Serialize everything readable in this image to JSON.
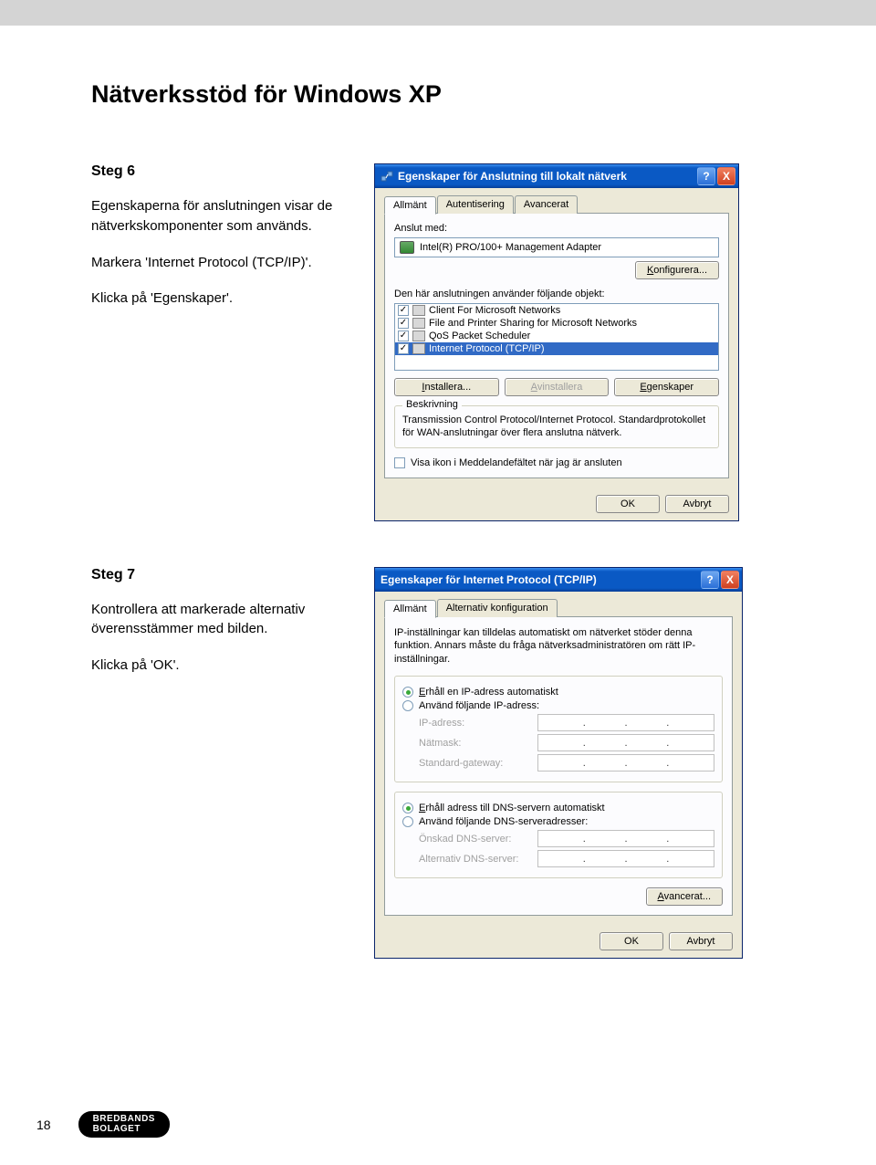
{
  "page": {
    "title": "Nätverksstöd för Windows XP",
    "number": "18",
    "logo_line1": "BREDBANDS",
    "logo_line2": "BOLAGET"
  },
  "step6": {
    "heading": "Steg 6",
    "p1": "Egenskaperna för anslutningen visar de nätverkskomponenter som används.",
    "p2": "Markera 'Internet Protocol (TCP/IP)'.",
    "p3": "Klicka på 'Egenskaper'."
  },
  "step7": {
    "heading": "Steg 7",
    "p1": "Kontrollera att markerade alternativ överensstämmer med bilden.",
    "p2": "Klicka på 'OK'."
  },
  "win1": {
    "title": "Egenskaper för Anslutning till lokalt nätverk",
    "help": "?",
    "close": "X",
    "tabs": {
      "t1": "Allmänt",
      "t2": "Autentisering",
      "t3": "Avancerat"
    },
    "connect_with_label": "Anslut med:",
    "adapter": "Intel(R) PRO/100+ Management Adapter",
    "configure_btn": "Konfigurera...",
    "components_label": "Den här anslutningen använder följande objekt:",
    "items": {
      "i1": "Client For Microsoft Networks",
      "i2": "File and Printer Sharing for Microsoft Networks",
      "i3": "QoS Packet Scheduler",
      "i4": "Internet Protocol (TCP/IP)"
    },
    "btn_install": "Installera...",
    "btn_uninstall": "Avinstallera",
    "btn_props": "Egenskaper",
    "desc_title": "Beskrivning",
    "desc_text": "Transmission Control Protocol/Internet Protocol. Standardprotokollet för WAN-anslutningar över flera anslutna nätverk.",
    "show_icon": "Visa ikon i Meddelandefältet när jag är ansluten",
    "btn_ok": "OK",
    "btn_cancel": "Avbryt"
  },
  "win2": {
    "title": "Egenskaper för Internet Protocol (TCP/IP)",
    "help": "?",
    "close": "X",
    "tabs": {
      "t1": "Allmänt",
      "t2": "Alternativ konfiguration"
    },
    "info": "IP-inställningar kan tilldelas automatiskt om nätverket stöder denna funktion. Annars måste du fråga nätverksadministratören om rätt IP-inställningar.",
    "r_auto_ip": "Erhåll en IP-adress automatiskt",
    "r_manual_ip": "Använd följande IP-adress:",
    "f_ip": "IP-adress:",
    "f_mask": "Nätmask:",
    "f_gw": "Standard-gateway:",
    "r_auto_dns": "Erhåll adress till DNS-servern automatiskt",
    "r_manual_dns": "Använd följande DNS-serveradresser:",
    "f_dns1": "Önskad DNS-server:",
    "f_dns2": "Alternativ DNS-server:",
    "btn_adv": "Avancerat...",
    "btn_ok": "OK",
    "btn_cancel": "Avbryt"
  }
}
